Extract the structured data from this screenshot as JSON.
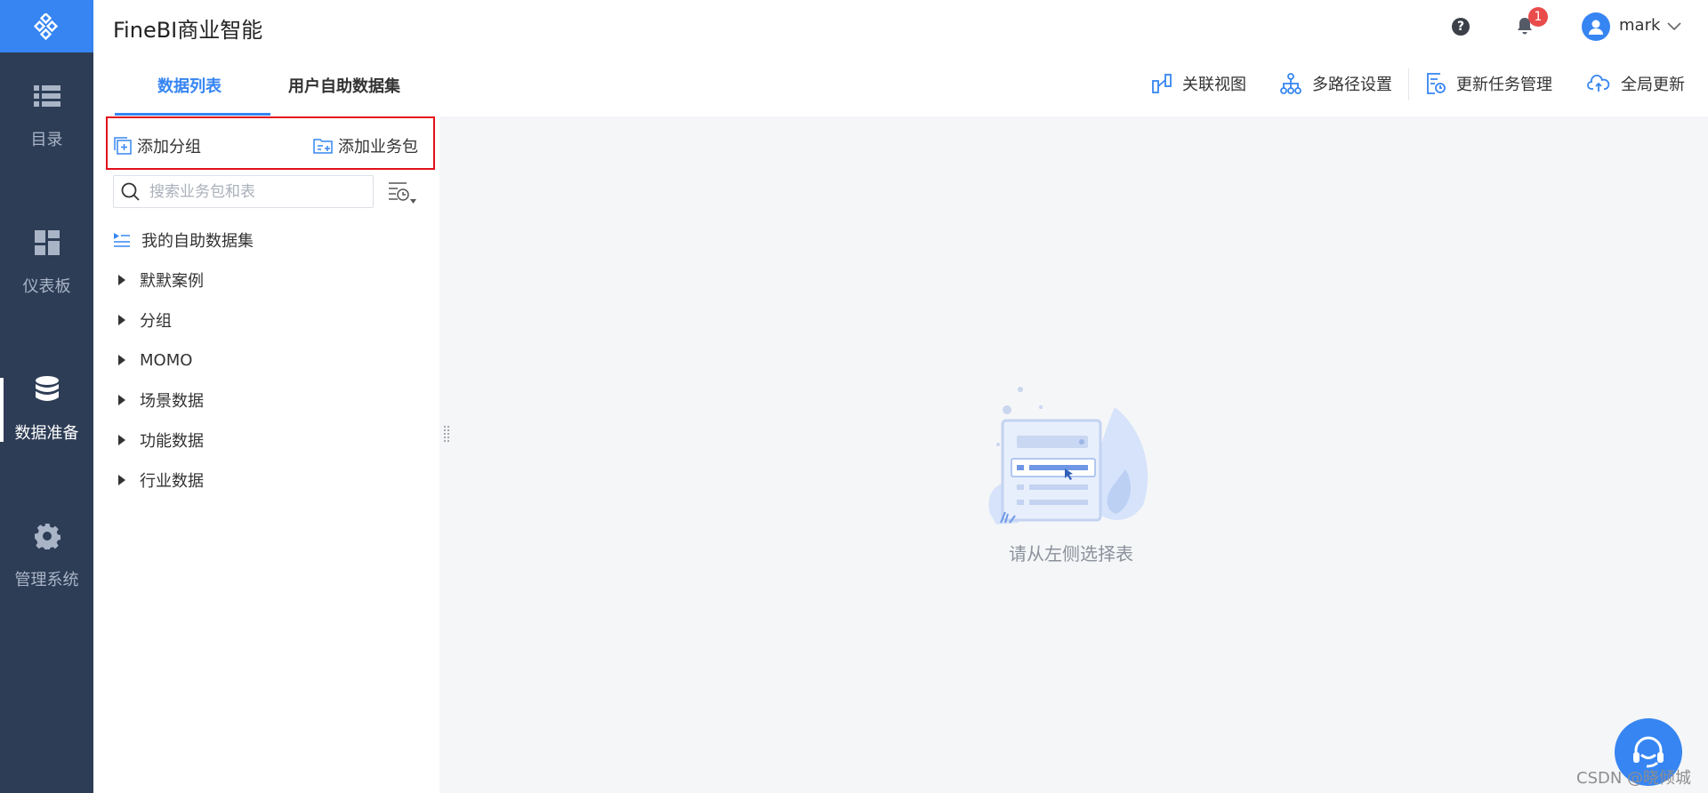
{
  "app": {
    "title": "FineBI商业智能"
  },
  "sidebar": {
    "items": [
      {
        "label": "目录",
        "icon": "list-icon"
      },
      {
        "label": "仪表板",
        "icon": "dashboard-icon"
      },
      {
        "label": "数据准备",
        "icon": "database-icon",
        "active": true
      },
      {
        "label": "管理系统",
        "icon": "gear-icon"
      }
    ]
  },
  "header": {
    "help_label": "?",
    "notification_count": "1",
    "username": "mark"
  },
  "tabs": [
    {
      "label": "数据列表",
      "active": true
    },
    {
      "label": "用户自助数据集",
      "active": false
    }
  ],
  "toolbar": {
    "relation_view": "关联视图",
    "multi_path": "多路径设置",
    "update_tasks": "更新任务管理",
    "global_update": "全局更新"
  },
  "panel": {
    "add_group": "添加分组",
    "add_package": "添加业务包",
    "search_placeholder": "搜索业务包和表",
    "self_dataset": "我的自助数据集",
    "tree": [
      "默默案例",
      "分组",
      "MOMO",
      "场景数据",
      "功能数据",
      "行业数据"
    ]
  },
  "empty_state": {
    "text": "请从左侧选择表"
  },
  "watermark": "CSDN @晓倾城",
  "colors": {
    "accent": "#3685f2",
    "sidebar": "#2e3d56",
    "highlight_box": "#e1111b",
    "badge": "#e94b4b"
  }
}
